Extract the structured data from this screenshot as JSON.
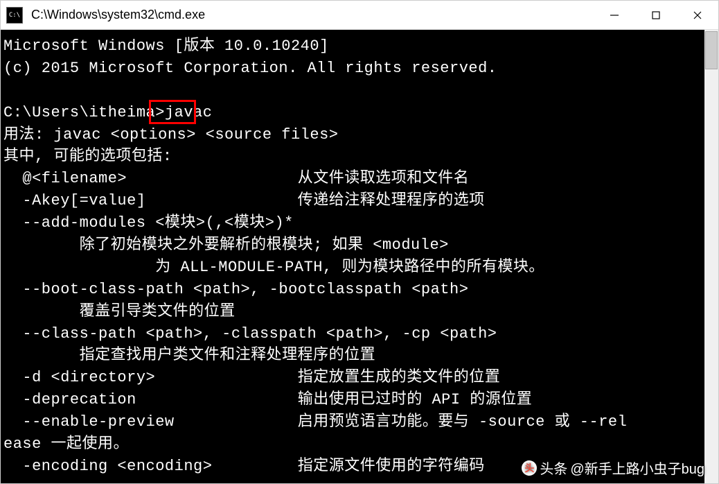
{
  "window": {
    "title": "C:\\Windows\\system32\\cmd.exe",
    "icon_label": "C:\\"
  },
  "terminal": {
    "lines": [
      "Microsoft Windows [版本 10.0.10240]",
      "(c) 2015 Microsoft Corporation. All rights reserved.",
      "",
      "C:\\Users\\itheima>javac",
      "用法: javac <options> <source files>",
      "其中, 可能的选项包括:",
      "  @<filename>                  从文件读取选项和文件名",
      "  -Akey[=value]                传递给注释处理程序的选项",
      "  --add-modules <模块>(,<模块>)*",
      "        除了初始模块之外要解析的根模块; 如果 <module>",
      "                为 ALL-MODULE-PATH, 则为模块路径中的所有模块。",
      "  --boot-class-path <path>, -bootclasspath <path>",
      "        覆盖引导类文件的位置",
      "  --class-path <path>, -classpath <path>, -cp <path>",
      "        指定查找用户类文件和注释处理程序的位置",
      "  -d <directory>               指定放置生成的类文件的位置",
      "  -deprecation                 输出使用已过时的 API 的源位置",
      "  --enable-preview             启用预览语言功能。要与 -source 或 --rel",
      "ease 一起使用。",
      "  -encoding <encoding>         指定源文件使用的字符编码"
    ]
  },
  "highlight": {
    "command": "javac"
  },
  "watermark": {
    "prefix": "头条",
    "text": "@新手上路小虫子bug"
  }
}
